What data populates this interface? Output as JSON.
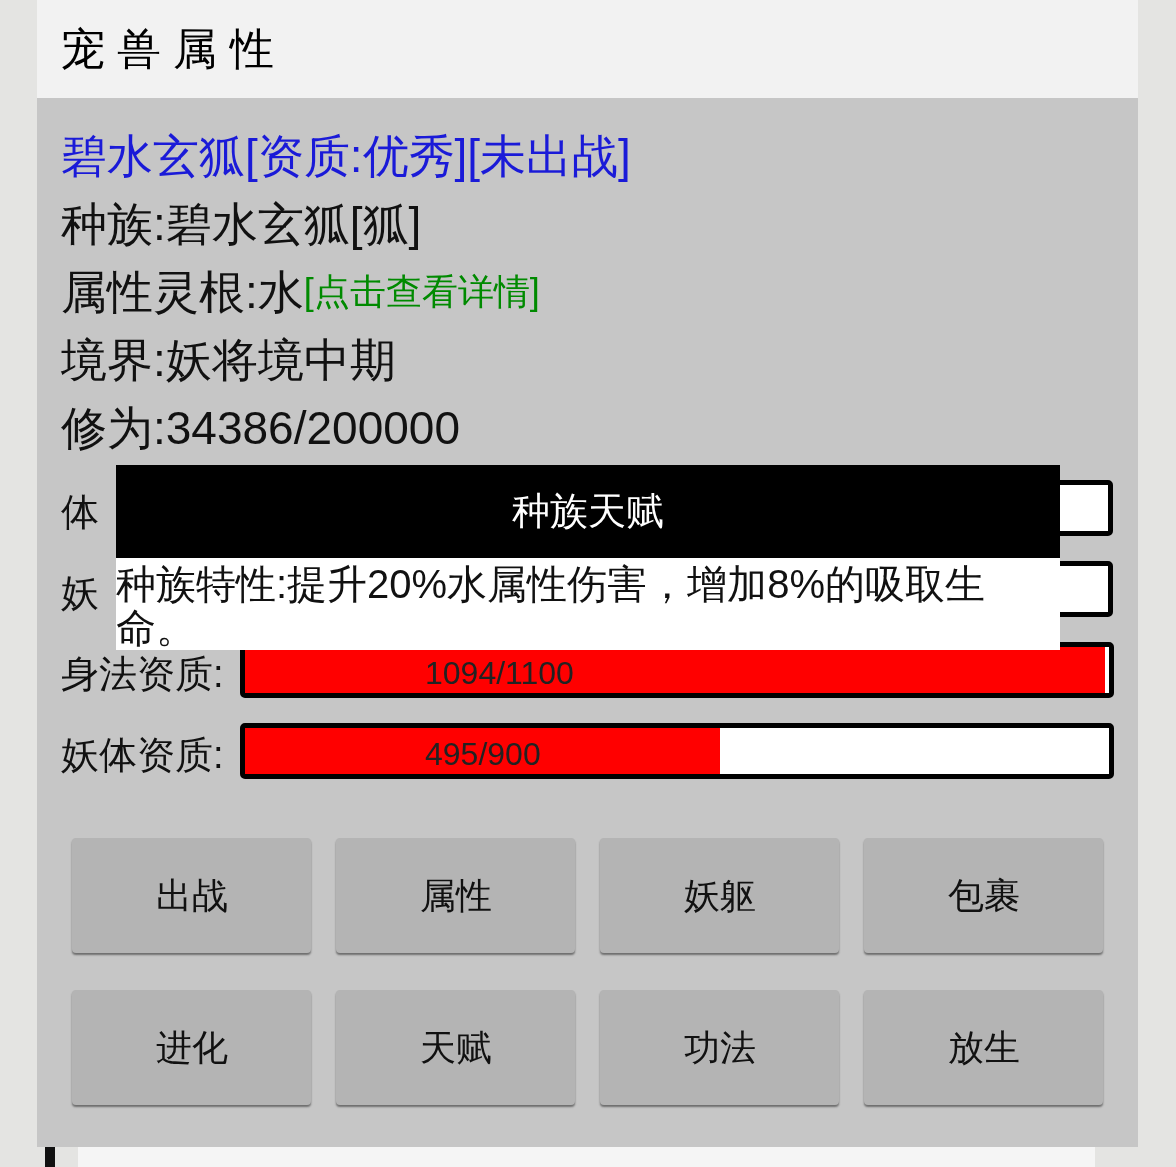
{
  "window": {
    "title": "宠 兽 属 性"
  },
  "pet": {
    "name_line": "碧水玄狐[资质:优秀][未出战]",
    "race": "种族:碧水玄狐[狐]",
    "element_label": "属性灵根:水",
    "element_link": "[点击查看详情]",
    "realm": "境界:妖将境中期",
    "cultivation": "修为:34386/200000"
  },
  "aptitudes": [
    {
      "label": "体"
    },
    {
      "label": "妖"
    },
    {
      "label": "身法资质:",
      "level": 0.995,
      "reading": "1094/1100"
    },
    {
      "label": "妖体资质:",
      "level": 0.55,
      "reading": "495/900"
    }
  ],
  "buttons": [
    "出战",
    "属性",
    "妖躯",
    "包裹",
    "进化",
    "天赋",
    "功法",
    "放生"
  ],
  "dialog": {
    "title": "种族天赋",
    "text": "种族特性:提升20%水属性伤害，增加8%的吸取生命。"
  }
}
